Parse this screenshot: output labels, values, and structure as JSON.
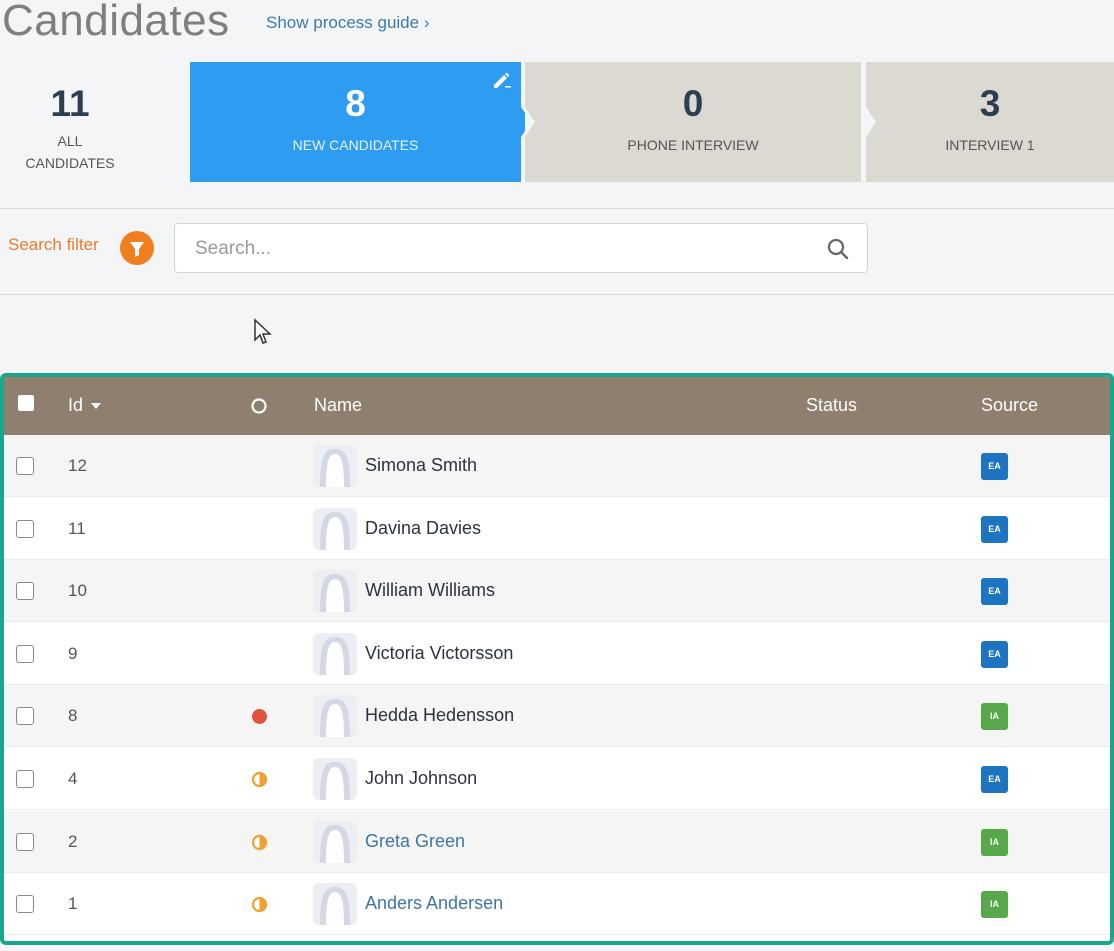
{
  "header": {
    "title": "Candidates",
    "process_guide_link": "Show process guide ›"
  },
  "pipeline": [
    {
      "count": "11",
      "label_line1": "ALL",
      "label_line2": "CANDIDATES"
    },
    {
      "count": "8",
      "label": "NEW CANDIDATES",
      "active": true
    },
    {
      "count": "0",
      "label": "PHONE INTERVIEW"
    },
    {
      "count": "3",
      "label": "INTERVIEW 1"
    }
  ],
  "filter": {
    "label": "Search filter",
    "search_placeholder": "Search...",
    "search_value": ""
  },
  "table": {
    "columns": {
      "id": "Id",
      "name": "Name",
      "status": "Status",
      "source": "Source"
    },
    "rows": [
      {
        "id": "12",
        "name": "Simona Smith",
        "status": "",
        "dot": "none",
        "source": "EA",
        "link": false
      },
      {
        "id": "11",
        "name": "Davina Davies",
        "status": "",
        "dot": "none",
        "source": "EA",
        "link": false
      },
      {
        "id": "10",
        "name": "William Williams",
        "status": "",
        "dot": "none",
        "source": "EA",
        "link": false
      },
      {
        "id": "9",
        "name": "Victoria Victorsson",
        "status": "",
        "dot": "none",
        "source": "EA",
        "link": false
      },
      {
        "id": "8",
        "name": "Hedda Hedensson",
        "status": "",
        "dot": "red",
        "source": "IA",
        "link": false
      },
      {
        "id": "4",
        "name": "John Johnson",
        "status": "",
        "dot": "half-orange",
        "source": "EA",
        "link": false
      },
      {
        "id": "2",
        "name": "Greta Green",
        "status": "",
        "dot": "half-orange",
        "source": "IA",
        "link": true
      },
      {
        "id": "1",
        "name": "Anders Andersen",
        "status": "",
        "dot": "half-orange",
        "source": "IA",
        "link": true
      }
    ]
  },
  "colors": {
    "active_stage": "#2e9cf0",
    "inactive_stage": "#dcd8d2",
    "table_header": "#8f7f6f",
    "table_border": "#1aa68c",
    "filter_accent": "#f07f1f",
    "source_EA": "#1d74c0",
    "source_IA": "#56a84a",
    "dot_red": "#e0533f",
    "dot_orange": "#f0a030"
  },
  "icons": [
    "pencil-edit-icon",
    "funnel-filter-icon",
    "magnifier-search-icon",
    "mouse-cursor-icon",
    "avatar-placeholder-icon",
    "sort-down-caret-icon",
    "status-circle-icon"
  ]
}
